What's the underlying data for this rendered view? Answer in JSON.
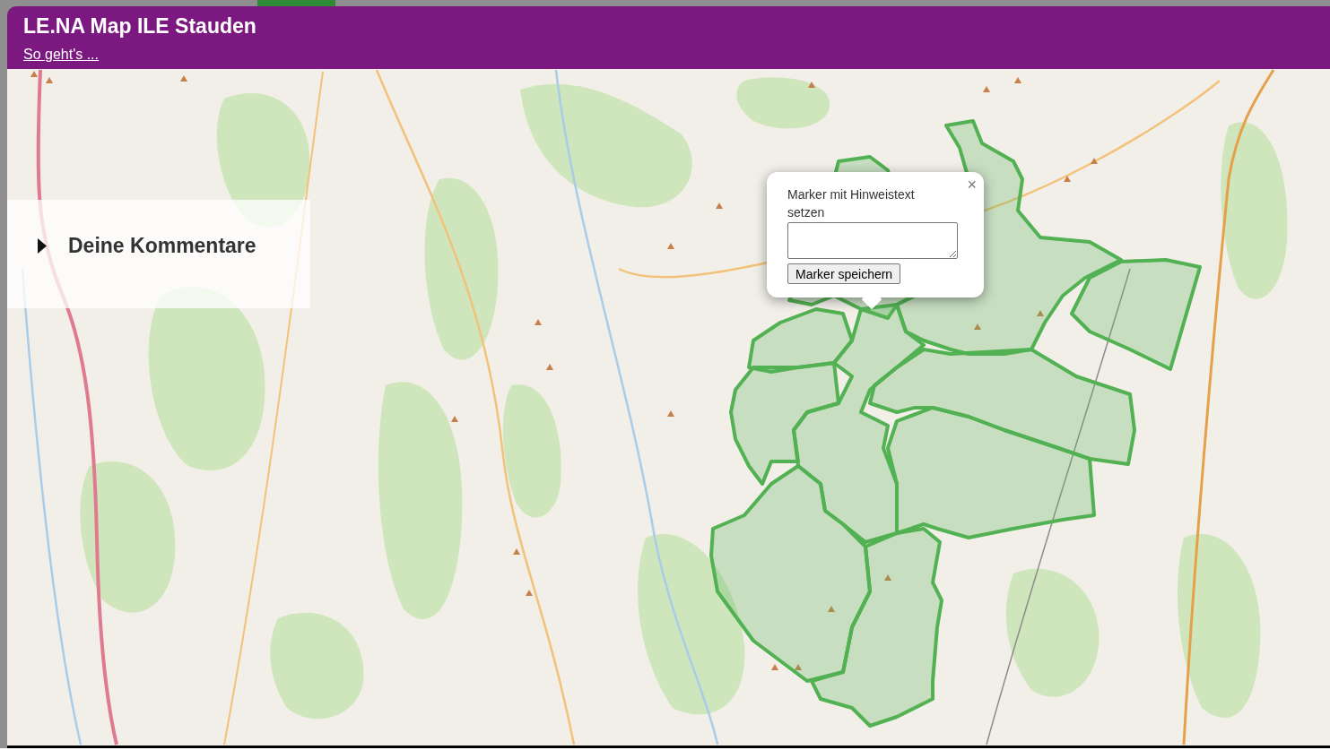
{
  "header": {
    "title": "LE.NA Map ILE Stauden",
    "help_link": "So geht's ..."
  },
  "comments_panel": {
    "title": "Deine Kommentare",
    "expanded": false
  },
  "popup": {
    "close": "×",
    "prompt": "Marker mit Hinweistext setzen",
    "save_button": "Marker speichern"
  }
}
